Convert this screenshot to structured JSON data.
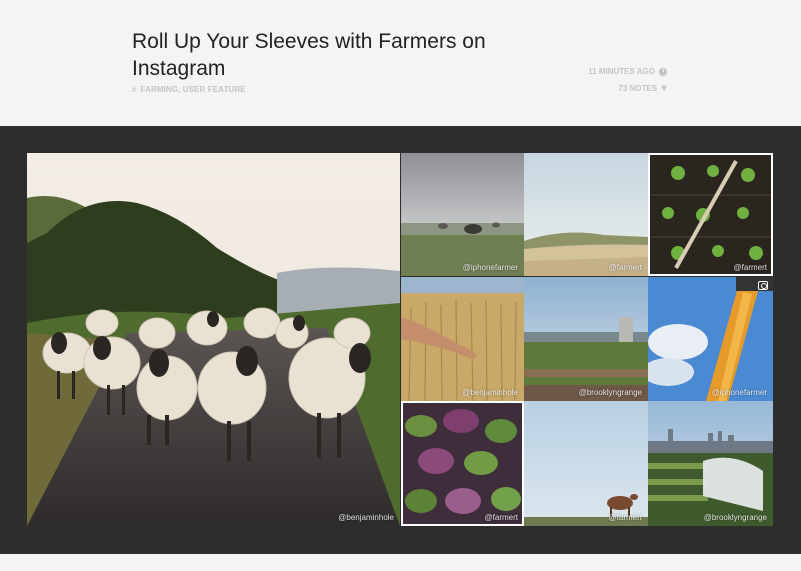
{
  "post": {
    "title": "Roll Up Your Sleeves with Farmers on Instagram",
    "tags": "FARMING, USER FEATURE",
    "time": "11 MINUTES AGO",
    "notes": "73 NOTES"
  },
  "photos": [
    {
      "credit": "@benjaminhole"
    },
    {
      "credit": "@iphonefarmer"
    },
    {
      "credit": "@farmert"
    },
    {
      "credit": "@farmert"
    },
    {
      "credit": "@benjaminhole"
    },
    {
      "credit": "@brooklyngrange"
    },
    {
      "credit": "@iphonefarmer"
    },
    {
      "credit": "@farmert"
    },
    {
      "credit": "@farmert"
    },
    {
      "credit": "@brooklyngrange"
    }
  ]
}
